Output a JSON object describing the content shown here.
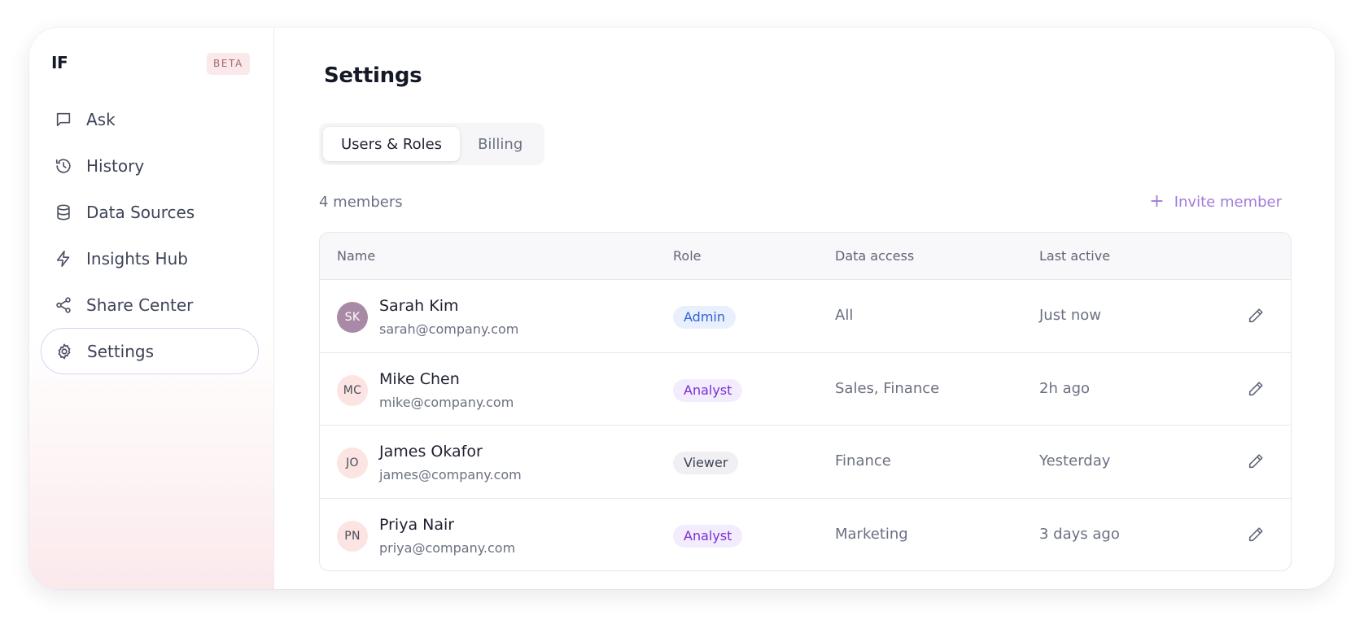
{
  "app": {
    "logo": "IF",
    "badge": "BETA"
  },
  "sidebar": {
    "items": [
      {
        "label": "Ask",
        "icon": "chat-bubble-icon",
        "active": false
      },
      {
        "label": "History",
        "icon": "history-icon",
        "active": false
      },
      {
        "label": "Data Sources",
        "icon": "database-icon",
        "active": false
      },
      {
        "label": "Insights Hub",
        "icon": "lightning-icon",
        "active": false
      },
      {
        "label": "Share Center",
        "icon": "share-icon",
        "active": false
      },
      {
        "label": "Settings",
        "icon": "gear-icon",
        "active": true
      }
    ]
  },
  "main": {
    "title": "Settings",
    "tabs": [
      {
        "label": "Users & Roles",
        "active": true
      },
      {
        "label": "Billing",
        "active": false
      }
    ],
    "members_count": "4 members",
    "invite_label": "Invite member"
  },
  "table": {
    "columns": [
      "Name",
      "Role",
      "Data access",
      "Last active"
    ],
    "rows": [
      {
        "initials": "SK",
        "name": "Sarah Kim",
        "email": "sarah@company.com",
        "role": "Admin",
        "access": "All",
        "last_active": "Just now"
      },
      {
        "initials": "MC",
        "name": "Mike Chen",
        "email": "mike@company.com",
        "role": "Analyst",
        "access": "Sales, Finance",
        "last_active": "2h ago"
      },
      {
        "initials": "JO",
        "name": "James Okafor",
        "email": "james@company.com",
        "role": "Viewer",
        "access": "Finance",
        "last_active": "Yesterday"
      },
      {
        "initials": "PN",
        "name": "Priya Nair",
        "email": "priya@company.com",
        "role": "Analyst",
        "access": "Marketing",
        "last_active": "3 days ago"
      }
    ]
  },
  "colors": {
    "accent": "#9f7ddc",
    "admin_badge_bg": "#e9f0fd",
    "admin_badge_fg": "#2f63d8",
    "analyst_badge_bg": "#f3ecfd",
    "analyst_badge_fg": "#7a2fd6",
    "viewer_badge_bg": "#f0f0f3",
    "viewer_badge_fg": "#3e4357",
    "avatar_active_bg": "#a98aa6",
    "avatar_bg": "#fbe4e1"
  }
}
